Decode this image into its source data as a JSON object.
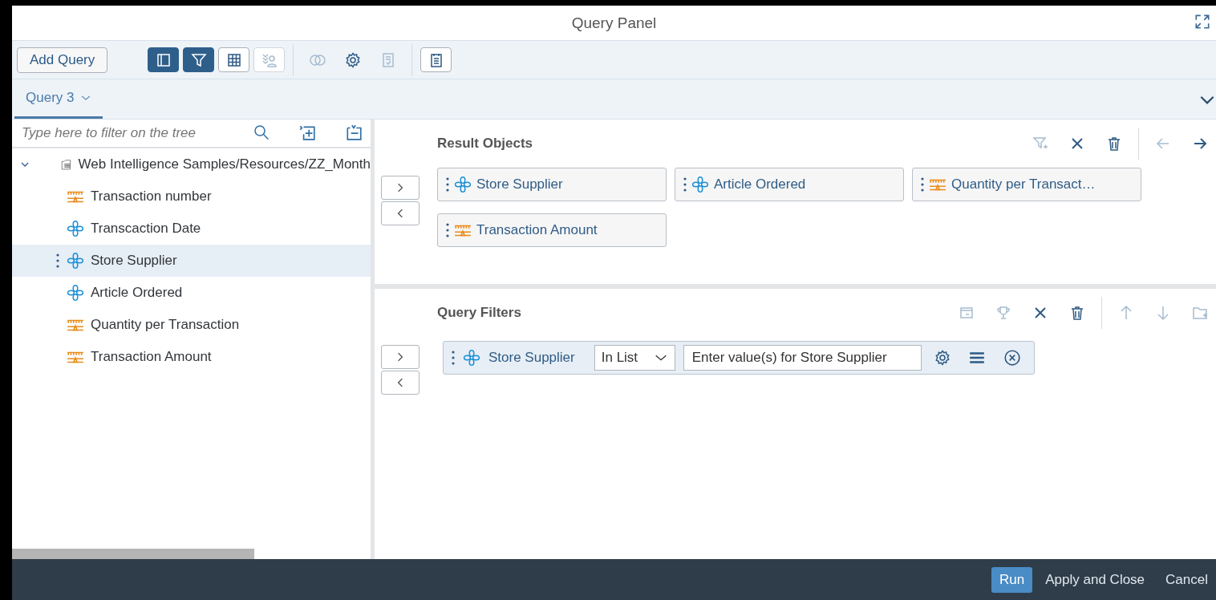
{
  "window": {
    "title": "Query Panel"
  },
  "toolbar": {
    "add_button": "Add Query",
    "groups": [
      [
        {
          "selected": true,
          "disabled": false
        },
        {
          "selected": true,
          "disabled": false
        },
        {
          "selected": false,
          "disabled": false
        },
        {
          "selected": false,
          "disabled": true
        }
      ],
      [
        {
          "selected": false,
          "disabled": true
        },
        {
          "selected": false,
          "disabled": false
        },
        {
          "selected": false,
          "disabled": true
        }
      ],
      [
        {
          "selected": false,
          "disabled": false
        }
      ]
    ]
  },
  "tabs": [
    {
      "label": "Query 3",
      "selected": true
    }
  ],
  "tree": {
    "placeholder": "Type here to filter on the tree",
    "items": [
      {
        "label": "Web Intelligence Samples/Resources/ZZ_Month",
        "kind": "universe",
        "expanded": true,
        "selected": false,
        "children": [
          {
            "label": "Transaction number",
            "kind": "measure",
            "selected": false
          },
          {
            "label": "Transcaction Date",
            "kind": "dimension",
            "selected": false
          },
          {
            "label": "Store Supplier",
            "kind": "dimension",
            "selected": true
          },
          {
            "label": "Article Ordered",
            "kind": "dimension",
            "selected": false
          },
          {
            "label": "Quantity per Transaction",
            "kind": "measure",
            "selected": false
          },
          {
            "label": "Transaction Amount",
            "kind": "measure",
            "selected": false
          }
        ]
      }
    ]
  },
  "result_objects": {
    "title": "Result Objects",
    "items": [
      {
        "label": "Store Supplier",
        "kind": "dimension"
      },
      {
        "label": "Article Ordered",
        "kind": "dimension"
      },
      {
        "label": "Quantity per Transact…",
        "kind": "measure"
      },
      {
        "label": "Transaction Amount",
        "kind": "measure"
      }
    ]
  },
  "query_filters": {
    "title": "Query Filters",
    "items": [
      {
        "object": "Store Supplier",
        "kind": "dimension",
        "operator": "In List",
        "placeholder": "Enter value(s) for Store Supplier"
      }
    ]
  },
  "footer": {
    "buttons": [
      {
        "label": "Run",
        "kind": "primary"
      },
      {
        "label": "Apply and Close",
        "kind": "plain"
      },
      {
        "label": "Cancel",
        "kind": "plain"
      }
    ]
  }
}
